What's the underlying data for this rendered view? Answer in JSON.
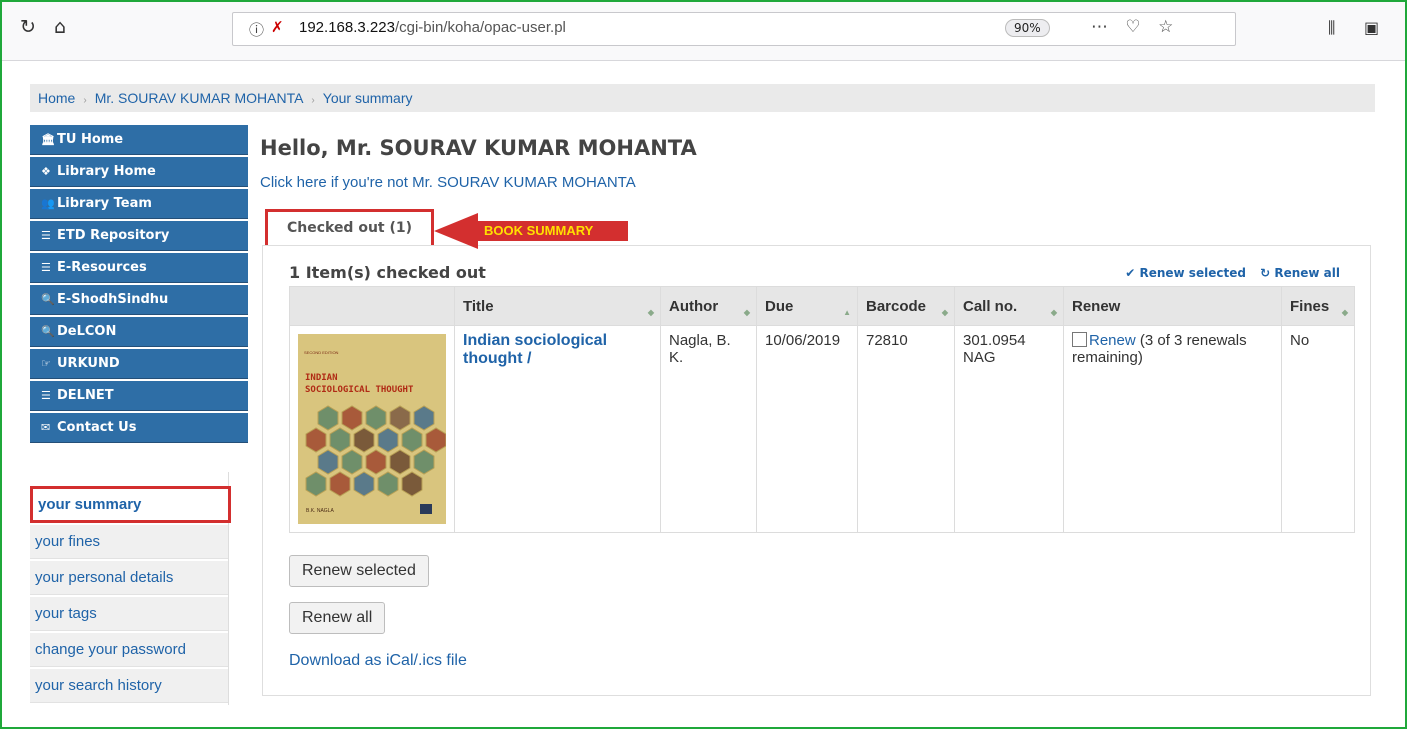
{
  "browser": {
    "url_host": "192.168.3.223",
    "url_path": "/cgi-bin/koha/opac-user.pl",
    "zoom": "90%",
    "icons": [
      "reload-icon",
      "home-icon",
      "info-icon",
      "insecure-lock-icon",
      "more-icon",
      "pocket-icon",
      "star-icon",
      "library-icon",
      "sidebar-icon"
    ]
  },
  "breadcrumb": {
    "items": [
      "Home",
      "Mr. SOURAV KUMAR MOHANTA",
      "Your summary"
    ]
  },
  "side_nav": {
    "items": [
      {
        "icon": "🏛",
        "label": "TU Home"
      },
      {
        "icon": "❖",
        "label": "Library Home"
      },
      {
        "icon": "👥",
        "label": "Library Team"
      },
      {
        "icon": "☰",
        "label": "ETD Repository"
      },
      {
        "icon": "☰",
        "label": "E-Resources"
      },
      {
        "icon": "🔍",
        "label": "E-ShodhSindhu"
      },
      {
        "icon": "🔍",
        "label": "DeLCON"
      },
      {
        "icon": "☞",
        "label": "URKUND"
      },
      {
        "icon": "☰",
        "label": "DELNET"
      },
      {
        "icon": "✉",
        "label": "Contact Us"
      }
    ]
  },
  "user_nav": {
    "items": [
      "your summary",
      "your fines",
      "your personal details",
      "your tags",
      "change your password",
      "your search history"
    ]
  },
  "main": {
    "greeting": "Hello, Mr. SOURAV KUMAR MOHANTA",
    "not_me_link": "Click here if you're not Mr. SOURAV KUMAR MOHANTA",
    "tab_label": "Checked out (1)",
    "annotation_label": "BOOK SUMMARY",
    "items_title": "1 Item(s) checked out",
    "renew_selected_link": "✔ Renew selected",
    "renew_all_link": "↻ Renew all",
    "table": {
      "headers": [
        "",
        "Title",
        "Author",
        "Due",
        "Barcode",
        "Call no.",
        "Renew",
        "Fines"
      ],
      "row": {
        "cover_edition": "SECOND EDITION",
        "cover_title": "INDIAN\nSOCIOLOGICAL THOUGHT",
        "cover_author": "B.K. NAGLA",
        "title": "Indian sociological thought /",
        "author": "Nagla, B. K.",
        "due": "10/06/2019",
        "barcode": "72810",
        "call_no": "301.0954 NAG",
        "renew_link": "Renew",
        "renew_note": " (3 of 3 renewals remaining)",
        "fines": "No"
      }
    },
    "renew_selected_button": "Renew selected",
    "renew_all_button": "Renew all",
    "download_link": "Download as iCal/.ics file"
  },
  "colors": {
    "nav_blue": "#2e6ea6",
    "link_blue": "#1f63a8",
    "highlight_red": "#d32f2f",
    "annotation_yellow": "#ffe000",
    "frame_green": "#1fa83a"
  }
}
